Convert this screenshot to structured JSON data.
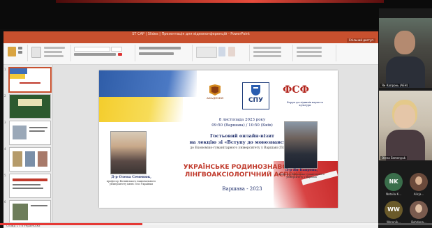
{
  "window": {
    "title": "ST CAP | Slides | Презентація для відеоконференцій - PowerPoint"
  },
  "ribbon": {
    "tabs": [
      "Файл",
      "Основне",
      "Вставлення",
      "Малювання",
      "Конструктор",
      "Переходи",
      "Анімація",
      "Слайд-шоу",
      "Рецензування",
      "Подання",
      "Довідка"
    ],
    "active_tab": "Основне",
    "share_label": "Спільний доступ"
  },
  "thumbnails": [
    "1",
    "2",
    "3",
    "4",
    "5",
    "6"
  ],
  "slide": {
    "logo_academy": "АКАДЕМІЯ",
    "logo_spu": "СПУ",
    "logo_fsf": "ФСФ",
    "logo_caption": "Форум дослідників науки та культури",
    "date": "8 листопада 2023 року",
    "time": "09:50 (Варшава) / 10:50 (Київ)",
    "guest_line1": "Гостьовий онлайн-візит",
    "guest_line2": "на лекцію зі «Вступу до мовознавства»",
    "guest_line3": "до Економіко-гуманітарного університету у Варшаві (Польща)",
    "title_line1": "УКРАЇНСЬКЕ РОДИНОЗНАВСТВО:",
    "title_line2": "ЛІНГВОАКСІОЛОГІЧНИЙ АСПЕКТ",
    "place_year": "Варшава - 2023",
    "left_person_name": "Д-р Олена Семенюк,",
    "left_person_title": "професор Волинського національного університету імені Лесі Українки",
    "right_person_name": "Д-р Ян Капронь,",
    "right_person_title": "професор Економіко-гуманітарного університету у Варшаві"
  },
  "statusbar": {
    "text": "Слайд 1 з 6   Українська"
  },
  "video": {
    "progress_fraction": 0.33
  },
  "participants": {
    "tiles": [
      {
        "name": "Ян Капронь (АЕН)"
      },
      {
        "name": "Olena Semenyuk"
      }
    ],
    "avatars": [
      {
        "initials": "NK",
        "name": "Natalia K...",
        "color": "#3a6e4b"
      },
      {
        "initials": "",
        "name": "Alicja...",
        "color": "#6b4a3b"
      },
      {
        "initials": "WW",
        "name": "Weronik...",
        "color": "#6a5a2a"
      },
      {
        "initials": "",
        "name": "Bohdana...",
        "color": "#7a5b4e"
      }
    ]
  },
  "colors": {
    "ppt_accent": "#c8502e",
    "slide_red": "#c0392b",
    "slide_blue": "#1f2e6b",
    "progress": "#e53935"
  }
}
